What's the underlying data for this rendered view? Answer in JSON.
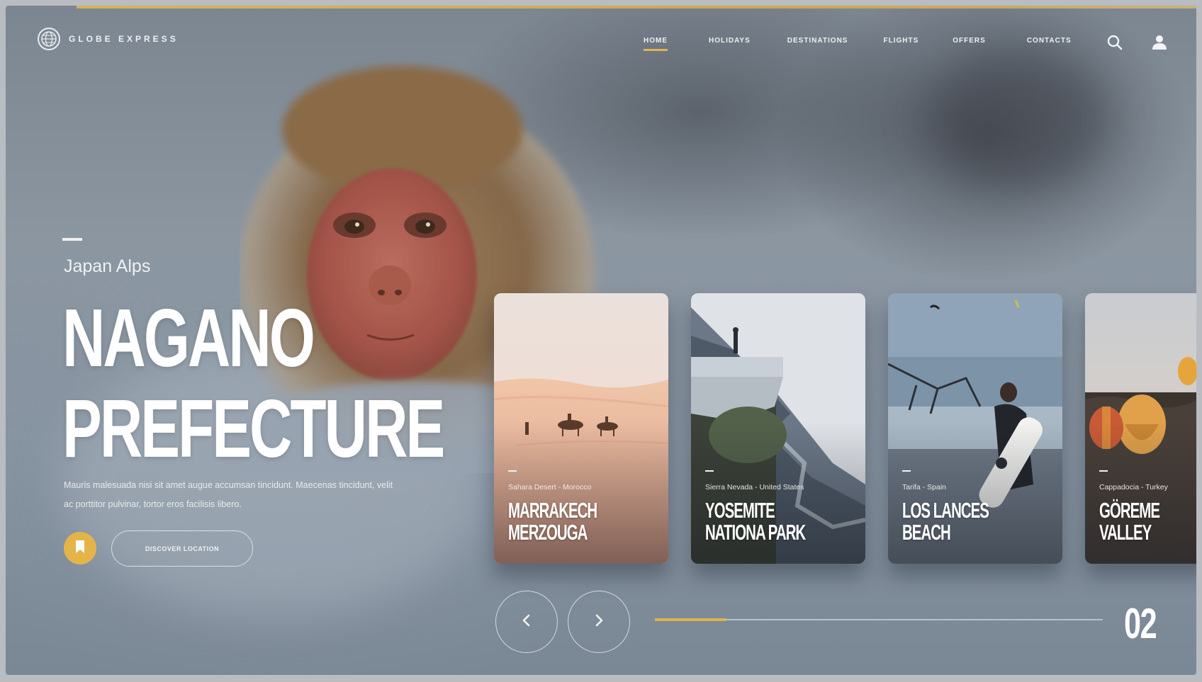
{
  "brand": {
    "name": "GLOBE EXPRESS",
    "logo_icon": "globe-icon"
  },
  "nav": {
    "items": [
      {
        "label": "Home",
        "active": true
      },
      {
        "label": "Holidays",
        "active": false
      },
      {
        "label": "Destinations",
        "active": false
      },
      {
        "label": "Flights",
        "active": false
      },
      {
        "label": "Offers",
        "active": false
      },
      {
        "label": "Contacts",
        "active": false
      }
    ],
    "search_icon": "search-icon",
    "user_icon": "user-icon"
  },
  "hero": {
    "subtitle": "Japan Alps",
    "title_line1": "NAGANO",
    "title_line2": "PREFECTURE",
    "description": "Mauris malesuada nisi sit amet augue accumsan tincidunt. Maecenas tincidunt, velit ac porttitor pulvinar, tortor eros facilisis libero.",
    "bookmark_icon": "bookmark-icon",
    "discover_label": "Discover Location"
  },
  "cards": [
    {
      "location": "Sahara Desert - Morocco",
      "title_line1": "MARRAKECH",
      "title_line2": "MERZOUGA"
    },
    {
      "location": "Sierra Nevada - United States",
      "title_line1": "YOSEMITE",
      "title_line2": "NATIONA PARK"
    },
    {
      "location": "Tarifa - Spain",
      "title_line1": "LOS LANCES",
      "title_line2": "BEACH"
    },
    {
      "location": "Cappadocia - Turkey",
      "title_line1": "GÖREME",
      "title_line2": "VALLEY"
    }
  ],
  "slider": {
    "prev_icon": "chevron-left-icon",
    "next_icon": "chevron-right-icon",
    "current": "02",
    "progress": 0.16
  },
  "colors": {
    "accent": "#e5b448",
    "text": "#eef1f3"
  }
}
